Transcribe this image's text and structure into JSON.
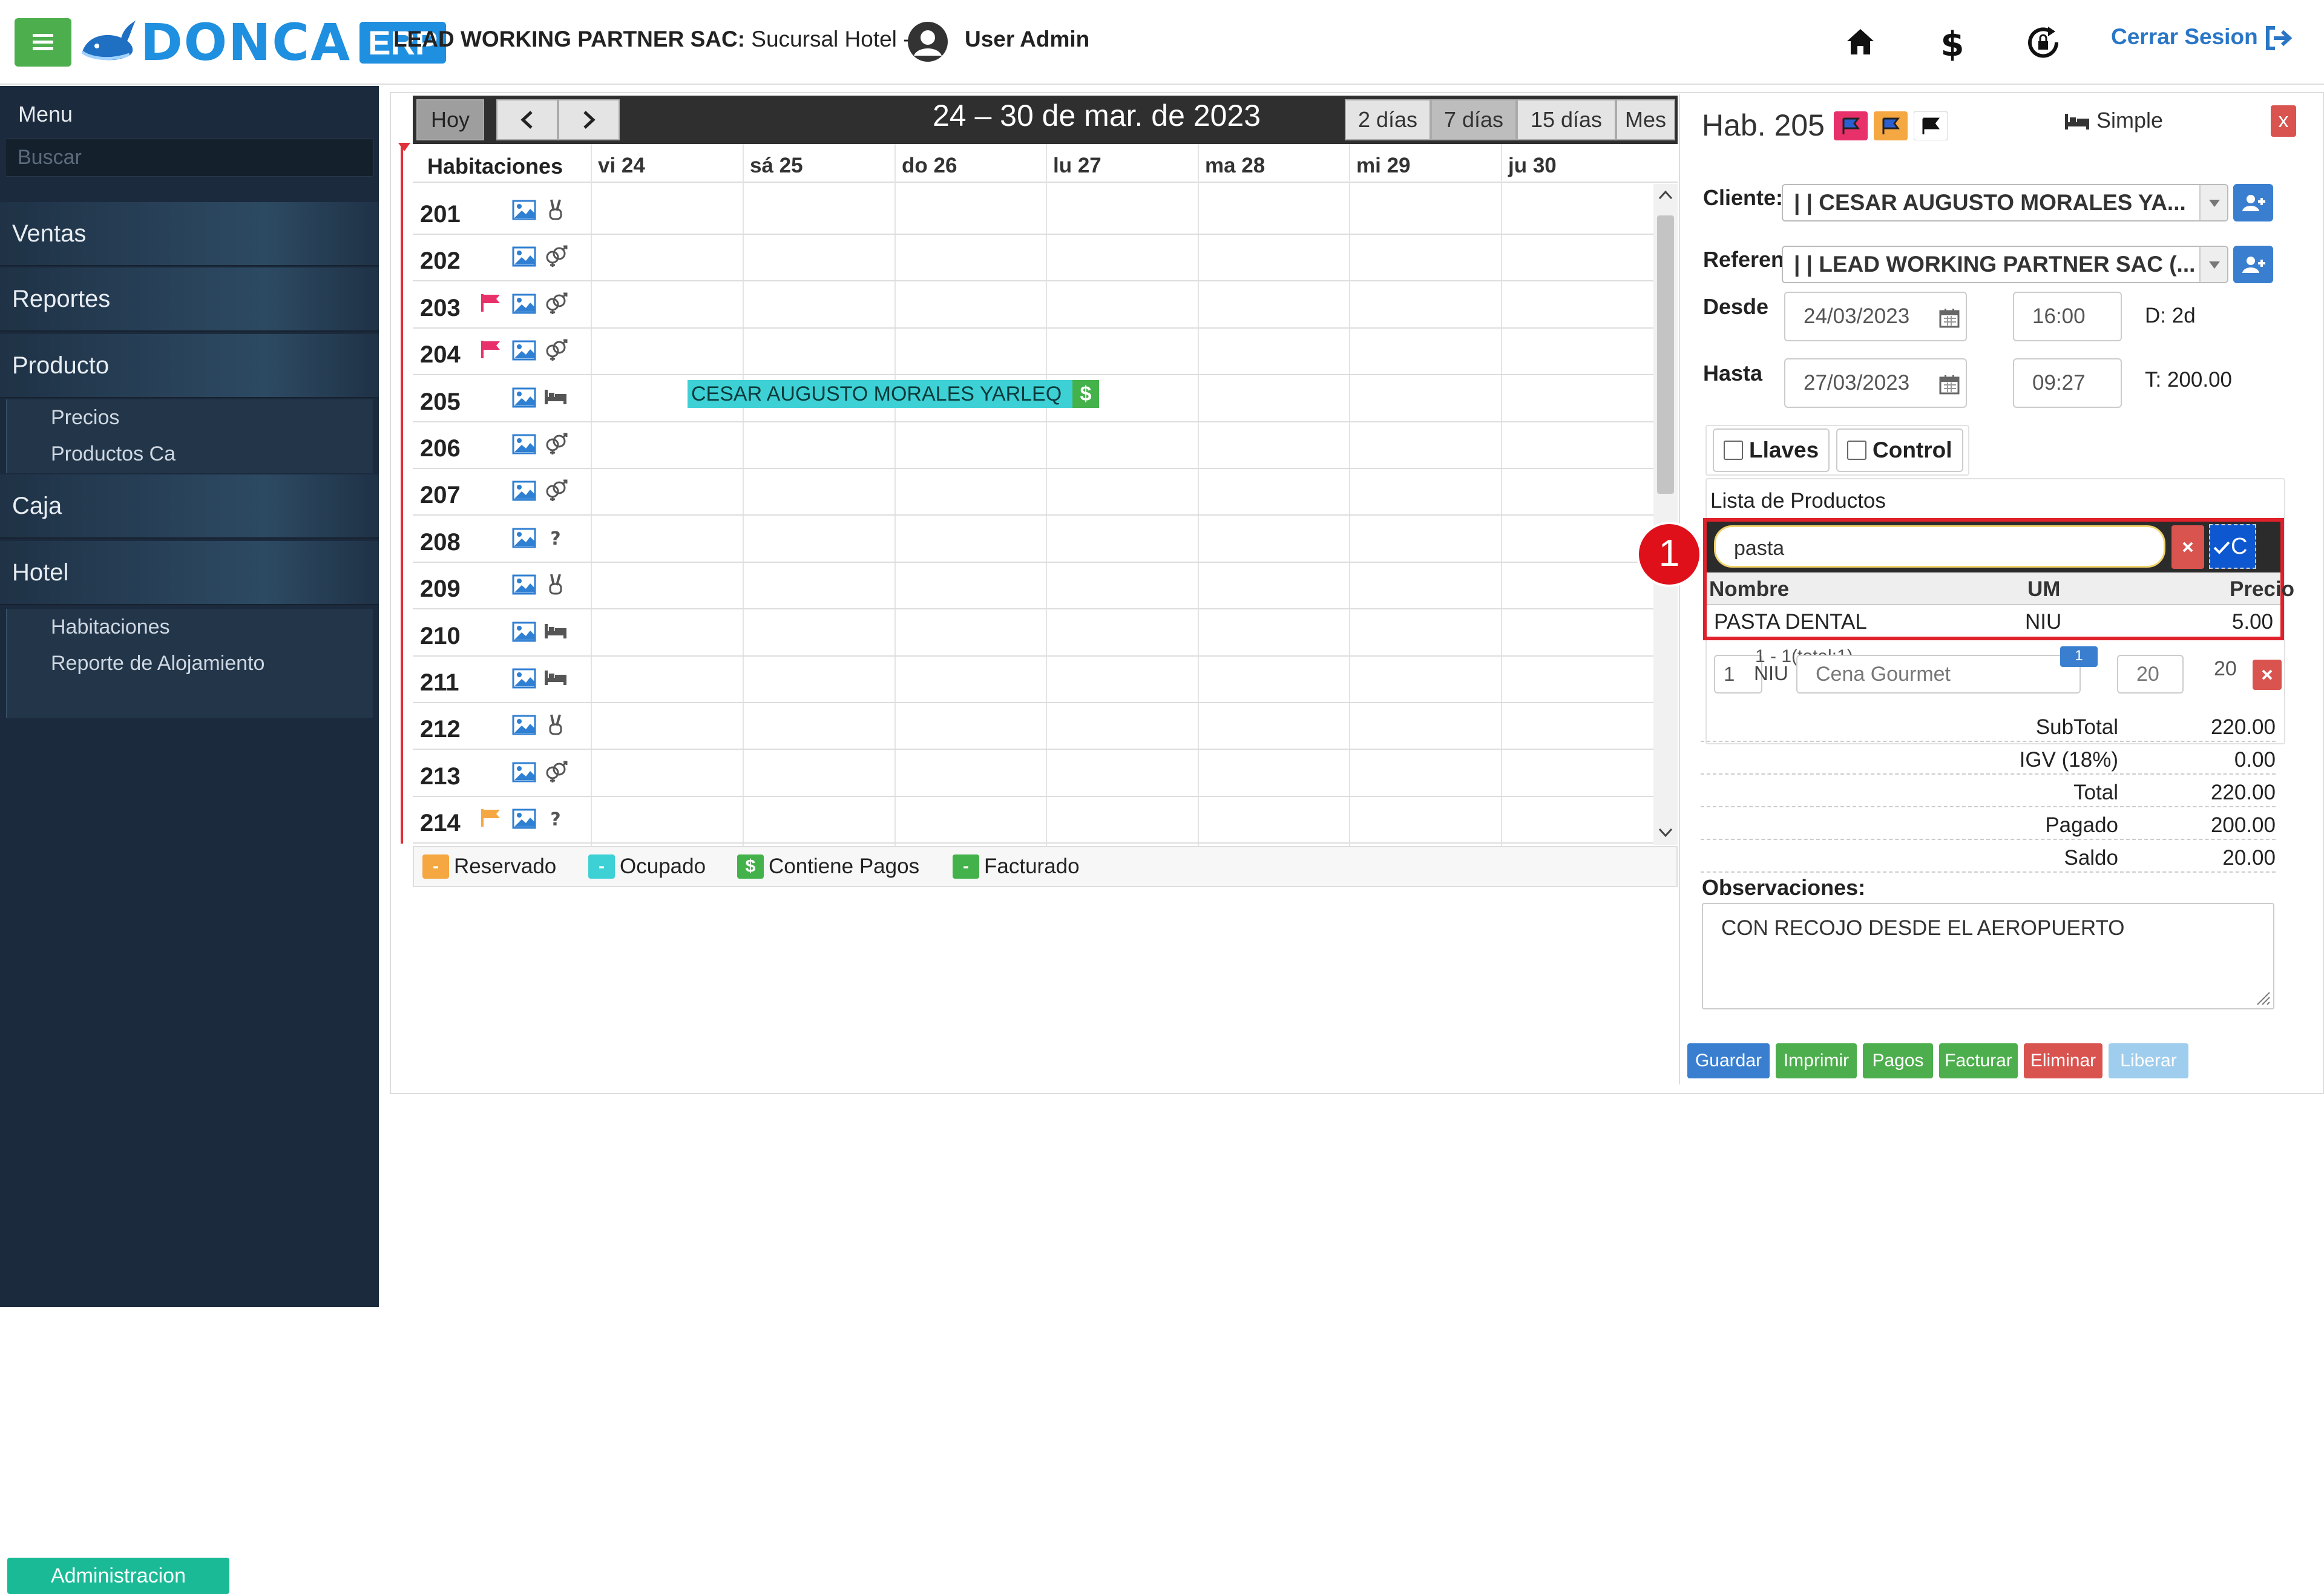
{
  "header": {
    "logo_text": "DONCA",
    "logo_badge": "ERP",
    "company_bold": "LEAD WORKING PARTNER SAC:",
    "company_rest": " Sucursal Hotel -- |",
    "user": "User Admin",
    "logout": "Cerrar Sesion"
  },
  "sidebar": {
    "menu_title": "Menu",
    "search_placeholder": "Buscar",
    "sections": [
      "Ventas",
      "Reportes",
      "Producto",
      "Caja",
      "Hotel"
    ],
    "producto_items": [
      "Precios",
      "Productos Ca"
    ],
    "hotel_items": [
      "Administracion",
      "Habitaciones",
      "Reporte de Alojamiento"
    ]
  },
  "calendar": {
    "today_button": "Hoy",
    "prev": "<",
    "next": ">",
    "title": "24 – 30 de mar. de 2023",
    "views": [
      "2 días",
      "7 días",
      "15 días",
      "Mes"
    ],
    "active_view": "7 días",
    "rooms_header": "Habitaciones",
    "days": [
      "vi 24",
      "sá 25",
      "do 26",
      "lu 27",
      "ma 28",
      "mi 29",
      "ju 30"
    ],
    "rooms": [
      {
        "num": "201",
        "flag": "",
        "type_icon": "victory-hand-icon"
      },
      {
        "num": "202",
        "flag": "",
        "type_icon": "couple-icon"
      },
      {
        "num": "203",
        "flag": "pink",
        "type_icon": "couple-icon"
      },
      {
        "num": "204",
        "flag": "pink",
        "type_icon": "couple-icon"
      },
      {
        "num": "205",
        "flag": "",
        "type_icon": "bed-icon"
      },
      {
        "num": "206",
        "flag": "",
        "type_icon": "couple-icon"
      },
      {
        "num": "207",
        "flag": "",
        "type_icon": "couple-icon"
      },
      {
        "num": "208",
        "flag": "",
        "type_icon": "question-icon"
      },
      {
        "num": "209",
        "flag": "",
        "type_icon": "victory-hand-icon"
      },
      {
        "num": "210",
        "flag": "",
        "type_icon": "bed-icon"
      },
      {
        "num": "211",
        "flag": "",
        "type_icon": "bed-icon"
      },
      {
        "num": "212",
        "flag": "",
        "type_icon": "victory-hand-icon"
      },
      {
        "num": "213",
        "flag": "",
        "type_icon": "couple-icon"
      },
      {
        "num": "214",
        "flag": "orange",
        "type_icon": "question-icon"
      }
    ],
    "event": {
      "label": "CESAR AUGUSTO MORALES YARLEQ",
      "pay_badge": "$",
      "room": "205"
    },
    "legend": [
      {
        "label": "Reservado",
        "color": "#f5a742",
        "glyph": "-"
      },
      {
        "label": "Ocupado",
        "color": "#3dd1d6",
        "glyph": "-"
      },
      {
        "label": "Contiene Pagos",
        "color": "#44b24a",
        "glyph": "$"
      },
      {
        "label": "Facturado",
        "color": "#44b24a",
        "glyph": "-"
      }
    ]
  },
  "room_panel": {
    "title": "Hab. 205",
    "room_type": "Simple",
    "close": "x",
    "cliente_label": "Cliente:",
    "cliente_value": "| | CESAR AUGUSTO MORALES YA...",
    "referencia_label": "Referen",
    "referencia_value": "| | LEAD WORKING PARTNER SAC (...",
    "desde_label": "Desde",
    "desde_date": "24/03/2023",
    "desde_time": "16:00",
    "duration": "D: 2d",
    "hasta_label": "Hasta",
    "hasta_date": "27/03/2023",
    "hasta_time": "09:27",
    "total_short": "T: 200.00",
    "llaves": "Llaves",
    "control": "Control",
    "products_title": "Lista de Productos",
    "search_value": "pasta",
    "check_label": "C",
    "cols": [
      "Nombre",
      "UM",
      "Precio"
    ],
    "result": {
      "name": "PASTA DENTAL",
      "um": "NIU",
      "price": "5.00"
    },
    "behind_row": {
      "qty": "1",
      "um": "NIU",
      "desc": "Cena Gourmet",
      "pager": "1 - 1(total:1)",
      "badge": "1",
      "price": "20",
      "total": "20"
    },
    "annotation": "1",
    "totals": [
      {
        "label": "SubTotal",
        "value": "220.00"
      },
      {
        "label": "IGV (18%)",
        "value": "0.00"
      },
      {
        "label": "Total",
        "value": "220.00"
      },
      {
        "label": "Pagado",
        "value": "200.00"
      },
      {
        "label": "Saldo",
        "value": "20.00"
      }
    ],
    "obs_label": "Observaciones:",
    "obs_value": "CON RECOJO DESDE EL AEROPUERTO",
    "actions": [
      {
        "label": "Guardar",
        "color": "#3a7fcf"
      },
      {
        "label": "Imprimir",
        "color": "#4cae4c"
      },
      {
        "label": "Pagos",
        "color": "#4cae4c"
      },
      {
        "label": "Facturar",
        "color": "#4cae4c"
      },
      {
        "label": "Eliminar",
        "color": "#d9534f"
      },
      {
        "label": "Liberar",
        "color": "#9fcdee"
      }
    ]
  }
}
